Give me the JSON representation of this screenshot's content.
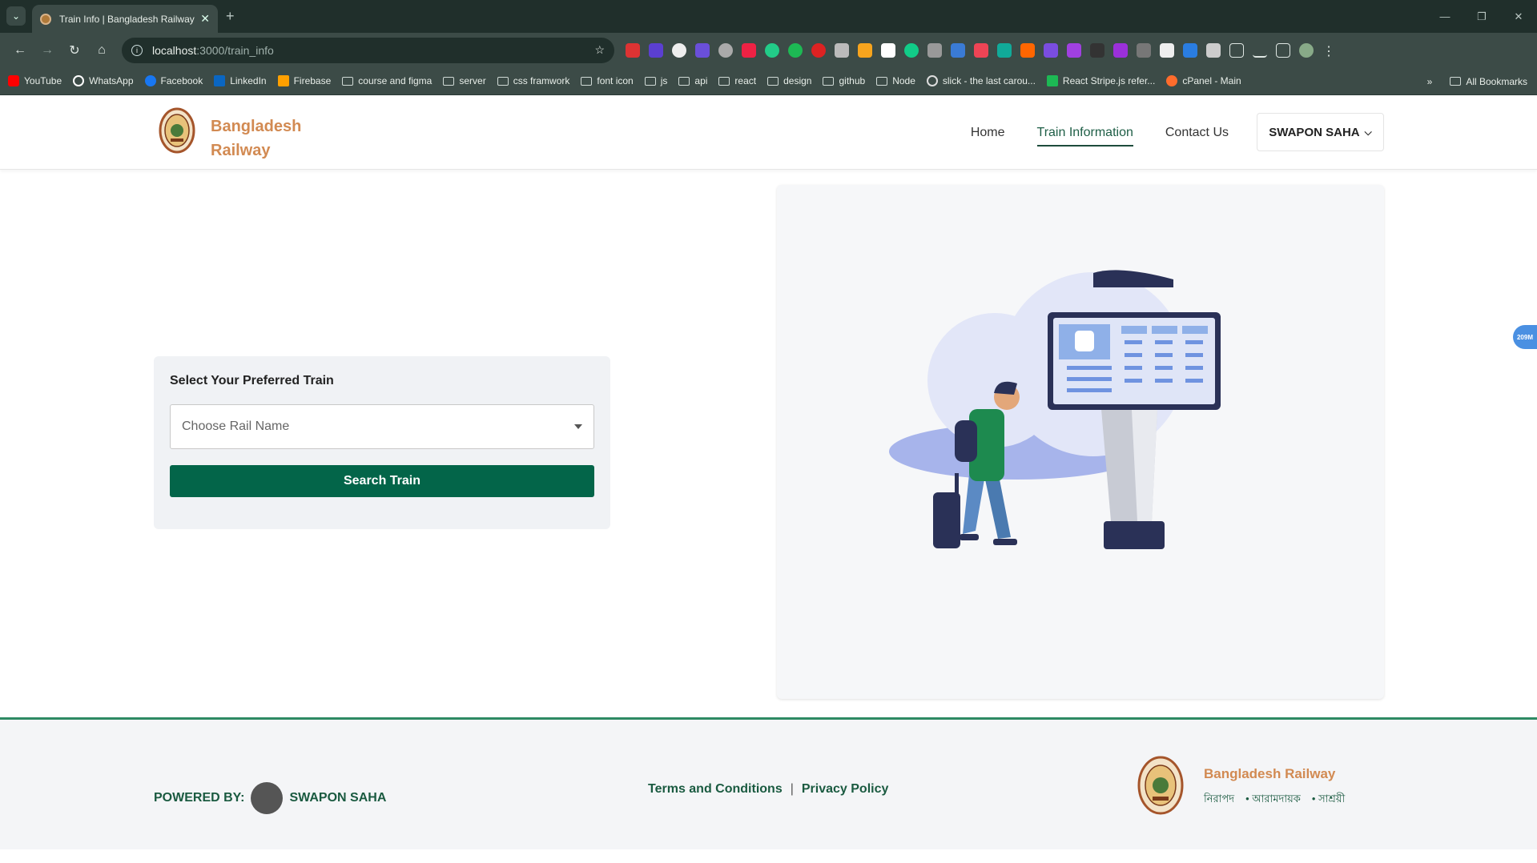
{
  "browser": {
    "tab_title": "Train Info | Bangladesh Railway",
    "url_host": "localhost",
    "url_path": ":3000/train_info",
    "bookmarks": [
      "YouTube",
      "WhatsApp",
      "Facebook",
      "LinkedIn",
      "Firebase",
      "course and figma",
      "server",
      "css framwork",
      "font icon",
      "js",
      "api",
      "react",
      "design",
      "github",
      "Node",
      "slick - the last carou...",
      "React Stripe.js refer...",
      "cPanel - Main"
    ],
    "all_bookmarks": "All Bookmarks",
    "more_bookmarks": "»"
  },
  "header": {
    "brand_line1": "Bangladesh",
    "brand_line2": "Railway",
    "nav": [
      "Home",
      "Train Information",
      "Contact Us"
    ],
    "user": "SWAPON SAHA"
  },
  "search": {
    "heading": "Select Your Preferred Train",
    "placeholder": "Choose Rail Name",
    "button": "Search Train"
  },
  "side_badge": "209M",
  "footer": {
    "powered_label": "POWERED BY:",
    "powered_name": "SWAPON SAHA",
    "terms": "Terms and Conditions",
    "separator": "|",
    "privacy": "Privacy Policy",
    "brand": "Bangladesh Railway",
    "tags": [
      "নিরাপদ",
      "আরামদায়ক",
      "সাশ্রয়ী"
    ]
  },
  "colors": {
    "primary": "#036549",
    "brand": "#d28a52",
    "chrome": "#3c4b47"
  }
}
